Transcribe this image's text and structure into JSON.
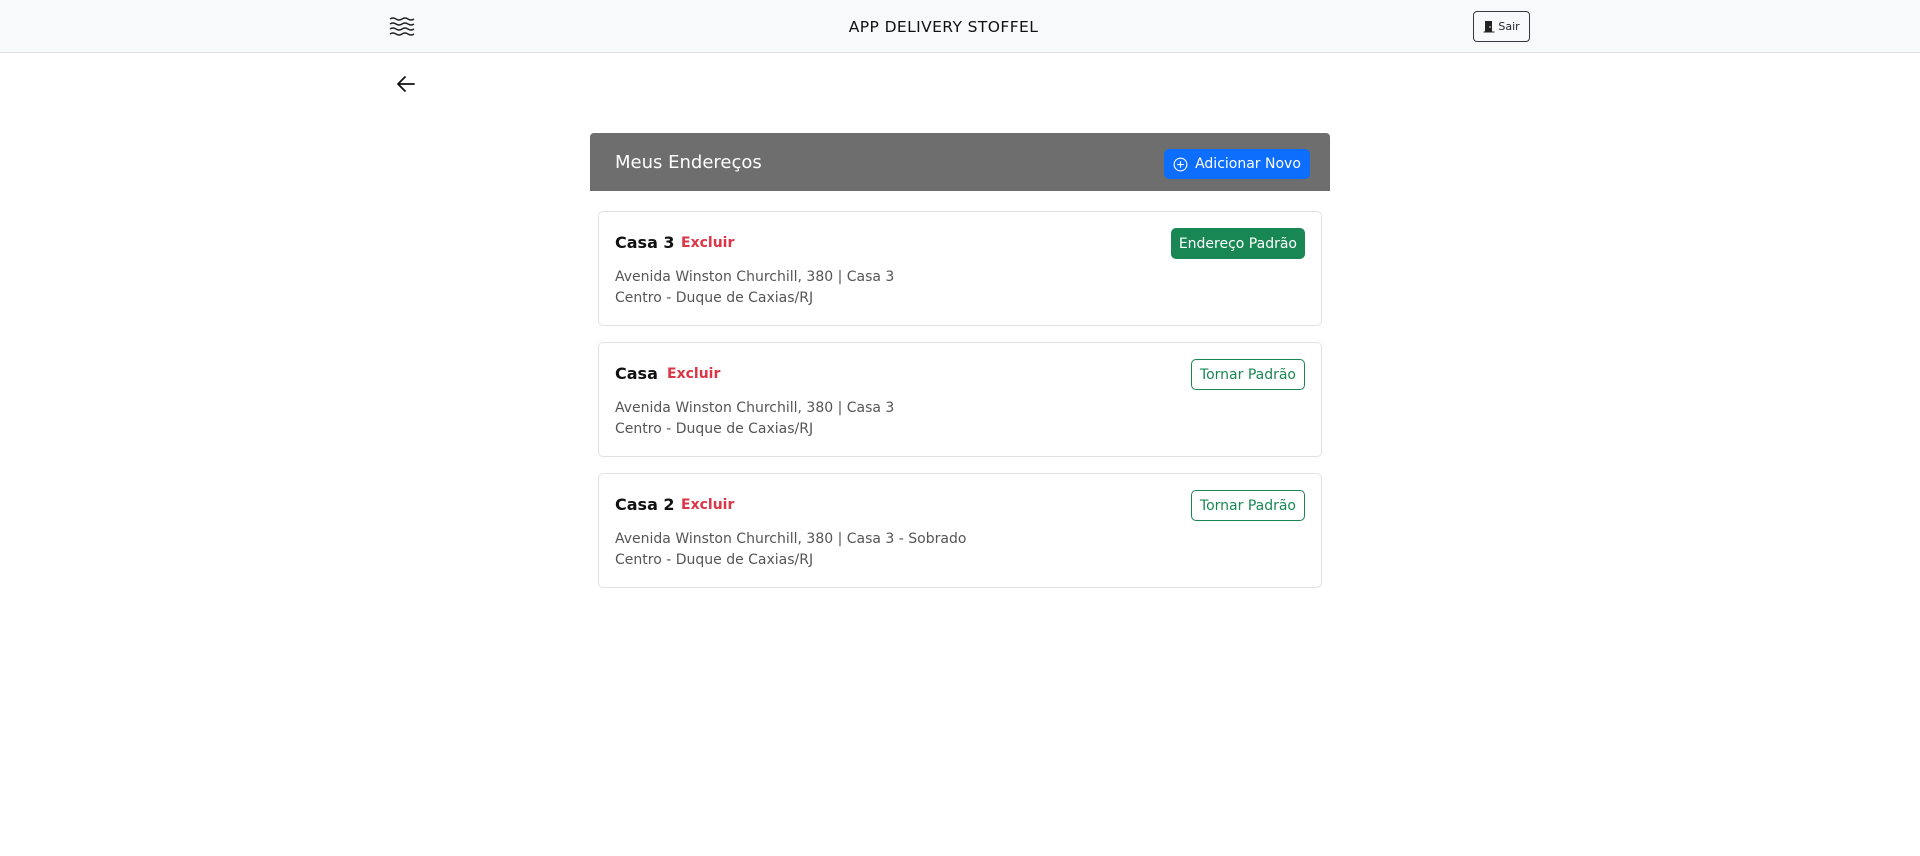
{
  "header": {
    "app_title": "APP DELIVERY STOFFEL",
    "logout_label": "Sair",
    "menu_icon": "waves-menu-icon",
    "logout_icon": "door-open-icon"
  },
  "nav": {
    "back_icon": "arrow-left-icon"
  },
  "panel": {
    "title": "Meus Endereços",
    "add_label": "Adicionar Novo",
    "add_icon": "plus-circle-icon"
  },
  "addresses": [
    {
      "name": "Casa 3",
      "delete_label": "Excluir",
      "line1": "Avenida Winston Churchill, 380 | Casa 3",
      "line2": "Centro - Duque de Caxias/RJ",
      "status_label": "Endereço Padrão",
      "is_default": true
    },
    {
      "name": "Casa",
      "delete_label": "Excluir",
      "line1": "Avenida Winston Churchill, 380 | Casa 3",
      "line2": "Centro - Duque de Caxias/RJ",
      "status_label": "Tornar Padrão",
      "is_default": false
    },
    {
      "name": "Casa 2",
      "delete_label": "Excluir",
      "line1": "Avenida Winston Churchill, 380 | Casa 3 - Sobrado",
      "line2": "Centro - Duque de Caxias/RJ",
      "status_label": "Tornar Padrão",
      "is_default": false
    }
  ],
  "colors": {
    "primary": "#0d6efd",
    "success": "#198754",
    "danger": "#dc3545",
    "panel_header": "#6e6e6e",
    "topbar": "#f8f9fa"
  }
}
